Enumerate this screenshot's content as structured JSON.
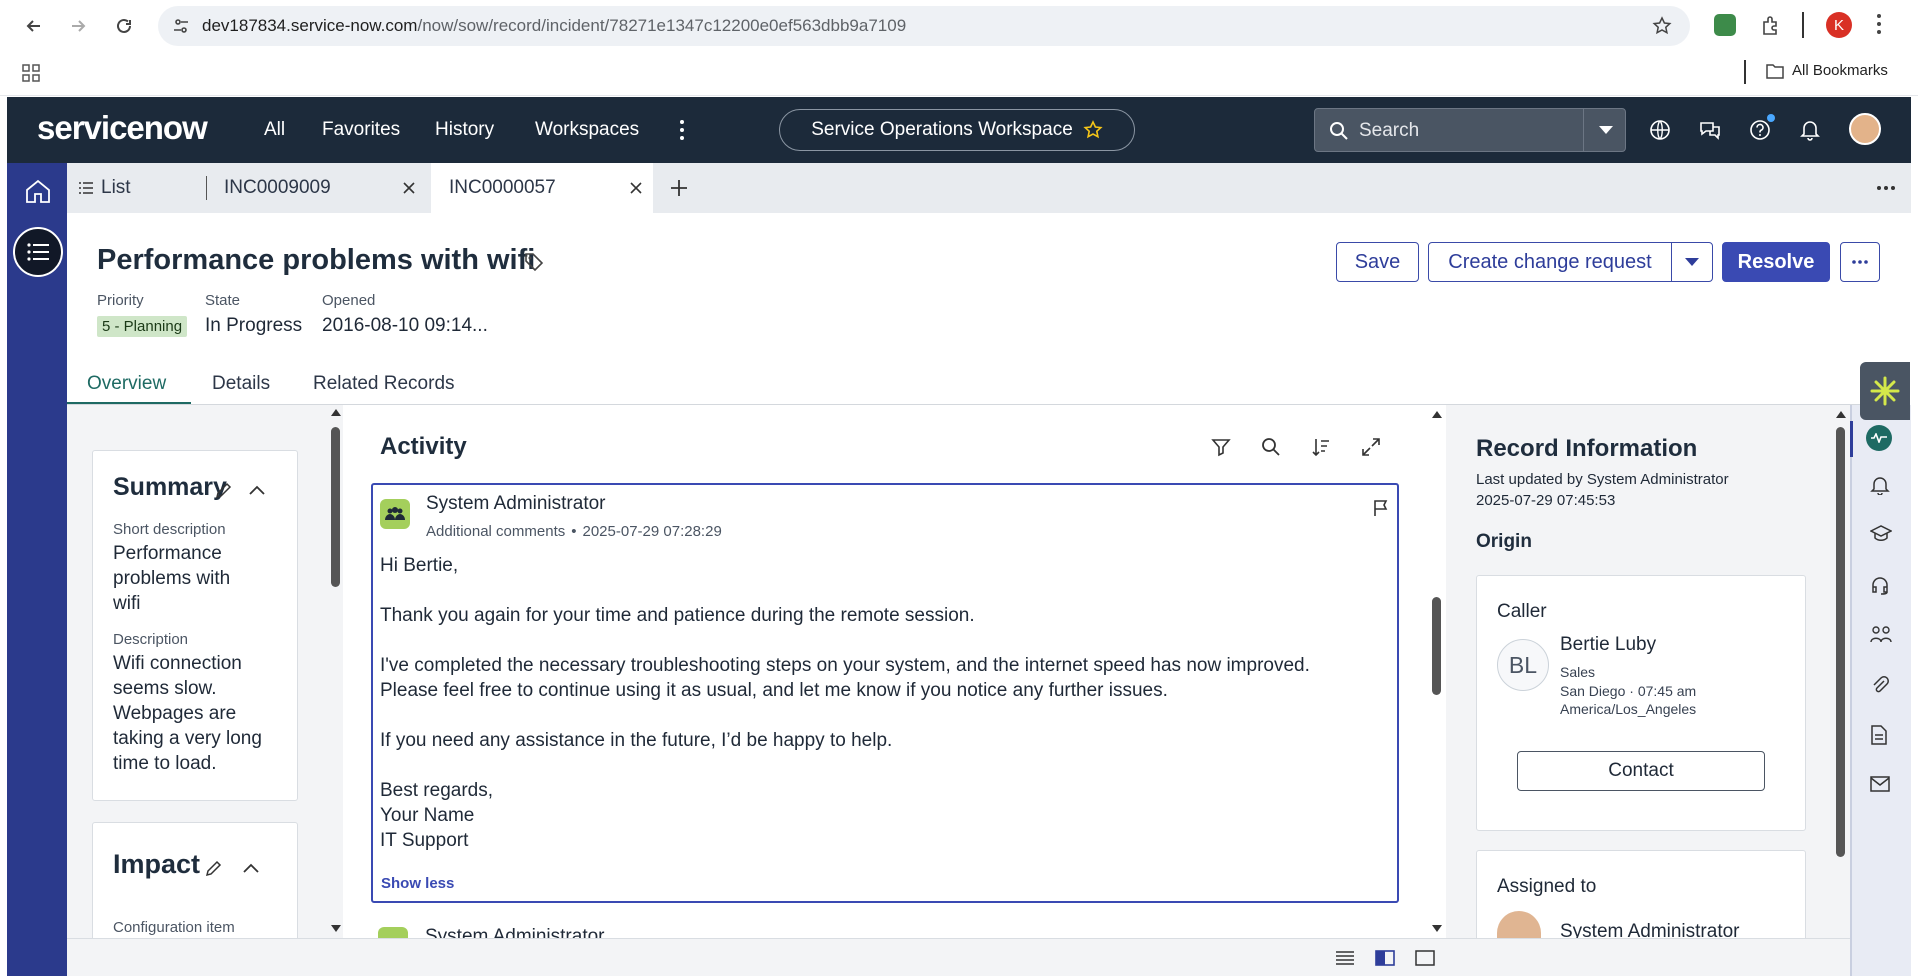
{
  "browser": {
    "url_host": "dev187834.service-now.com",
    "url_path": "/now/sow/record/incident/78271e1347c12200e0ef563dbb9a7109",
    "bookmarks_label": "All Bookmarks",
    "profile_initial": "K"
  },
  "header": {
    "logo": "servicenow",
    "menu": [
      "All",
      "Favorites",
      "History",
      "Workspaces"
    ],
    "workspace_name": "Service Operations Workspace",
    "search_placeholder": "Search"
  },
  "tabs": [
    {
      "label": "List"
    },
    {
      "label": "INC0009009"
    },
    {
      "label": "INC0000057"
    }
  ],
  "record": {
    "title": "Performance problems with wifi",
    "priority_label": "Priority",
    "priority_value": "5 - Planning",
    "state_label": "State",
    "state_value": "In Progress",
    "opened_label": "Opened",
    "opened_value": "2016-08-10 09:14...",
    "buttons": {
      "save": "Save",
      "create_change": "Create change request",
      "resolve": "Resolve"
    },
    "tabs": [
      "Overview",
      "Details",
      "Related Records"
    ]
  },
  "summary": {
    "title": "Summary",
    "short_desc_label": "Short description",
    "short_desc_lines": [
      "Performance",
      "problems with",
      "wifi"
    ],
    "desc_label": "Description",
    "desc_lines": [
      "Wifi connection",
      "seems slow.",
      "Webpages are",
      "taking a very long",
      "time to load."
    ]
  },
  "impact": {
    "title": "Impact",
    "ci_label": "Configuration item"
  },
  "activity": {
    "title": "Activity",
    "entry": {
      "author": "System Administrator",
      "type": "Additional comments",
      "timestamp": "2025-07-29 07:28:29",
      "lines": [
        "Hi Bertie,",
        "Thank you again for your time and patience during the remote session.",
        "I've completed the necessary troubleshooting steps on your system, and the internet speed has now improved.",
        "Please feel free to continue using it as usual, and let me know if you notice any further issues.",
        "If you need any assistance in the future, I’d be happy to help.",
        "Best regards,",
        "Your Name",
        "IT Support"
      ],
      "show_less": "Show less"
    },
    "next_author": "System Administrator"
  },
  "record_info": {
    "title": "Record Information",
    "last_updated": "Last updated by System Administrator",
    "last_updated_time": "2025-07-29 07:45:53",
    "origin_title": "Origin",
    "caller_label": "Caller",
    "caller_initials": "BL",
    "caller_name": "Bertie Luby",
    "caller_dept": "Sales",
    "caller_location": "San Diego · 07:45 am",
    "caller_tz": "America/Los_Angeles",
    "contact_button": "Contact",
    "assigned_label": "Assigned to",
    "assigned_name": "System Administrator"
  },
  "colors": {
    "header_bg": "#1c2a3a",
    "rail_bg": "#2b3a8c",
    "accent": "#3a4ab3",
    "badge_bg": "#cfe6c8"
  }
}
